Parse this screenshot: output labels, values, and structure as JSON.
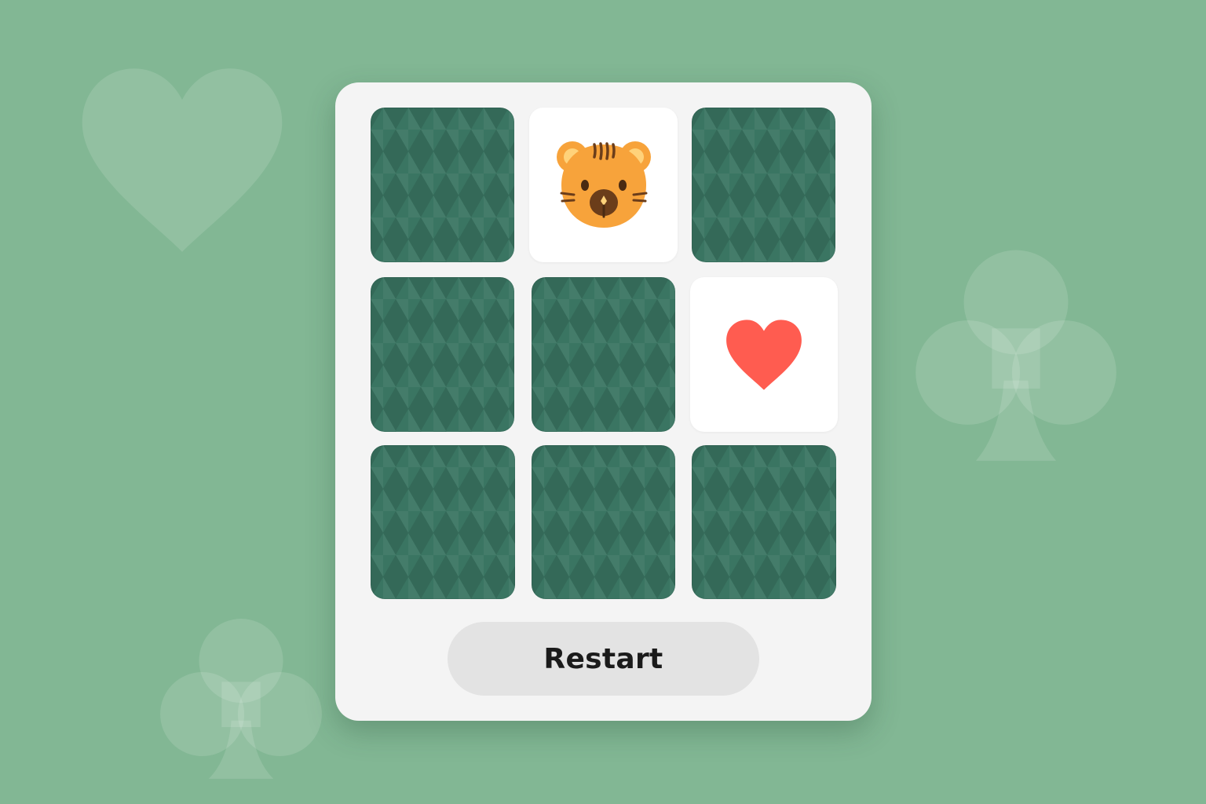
{
  "theme": {
    "background": "#82b794",
    "panel": "#f4f4f4",
    "card_back": "#3a7562",
    "card_face": "#ffffff",
    "heart_color": "#ff5c50",
    "tiger_color": "#f7a33b"
  },
  "background_decor": [
    {
      "suit": "heart",
      "icon": "heart-icon"
    },
    {
      "suit": "club",
      "icon": "club-icon"
    },
    {
      "suit": "club",
      "icon": "club-icon"
    }
  ],
  "board": {
    "rows": 3,
    "columns": 3,
    "cards": [
      {
        "state": "face-down"
      },
      {
        "state": "face-up",
        "symbol": "tiger-face-icon"
      },
      {
        "state": "face-down"
      },
      {
        "state": "face-down"
      },
      {
        "state": "face-down"
      },
      {
        "state": "face-up",
        "symbol": "heart-icon"
      },
      {
        "state": "face-down"
      },
      {
        "state": "face-down"
      },
      {
        "state": "face-down"
      }
    ]
  },
  "controls": {
    "restart_label": "Restart"
  }
}
